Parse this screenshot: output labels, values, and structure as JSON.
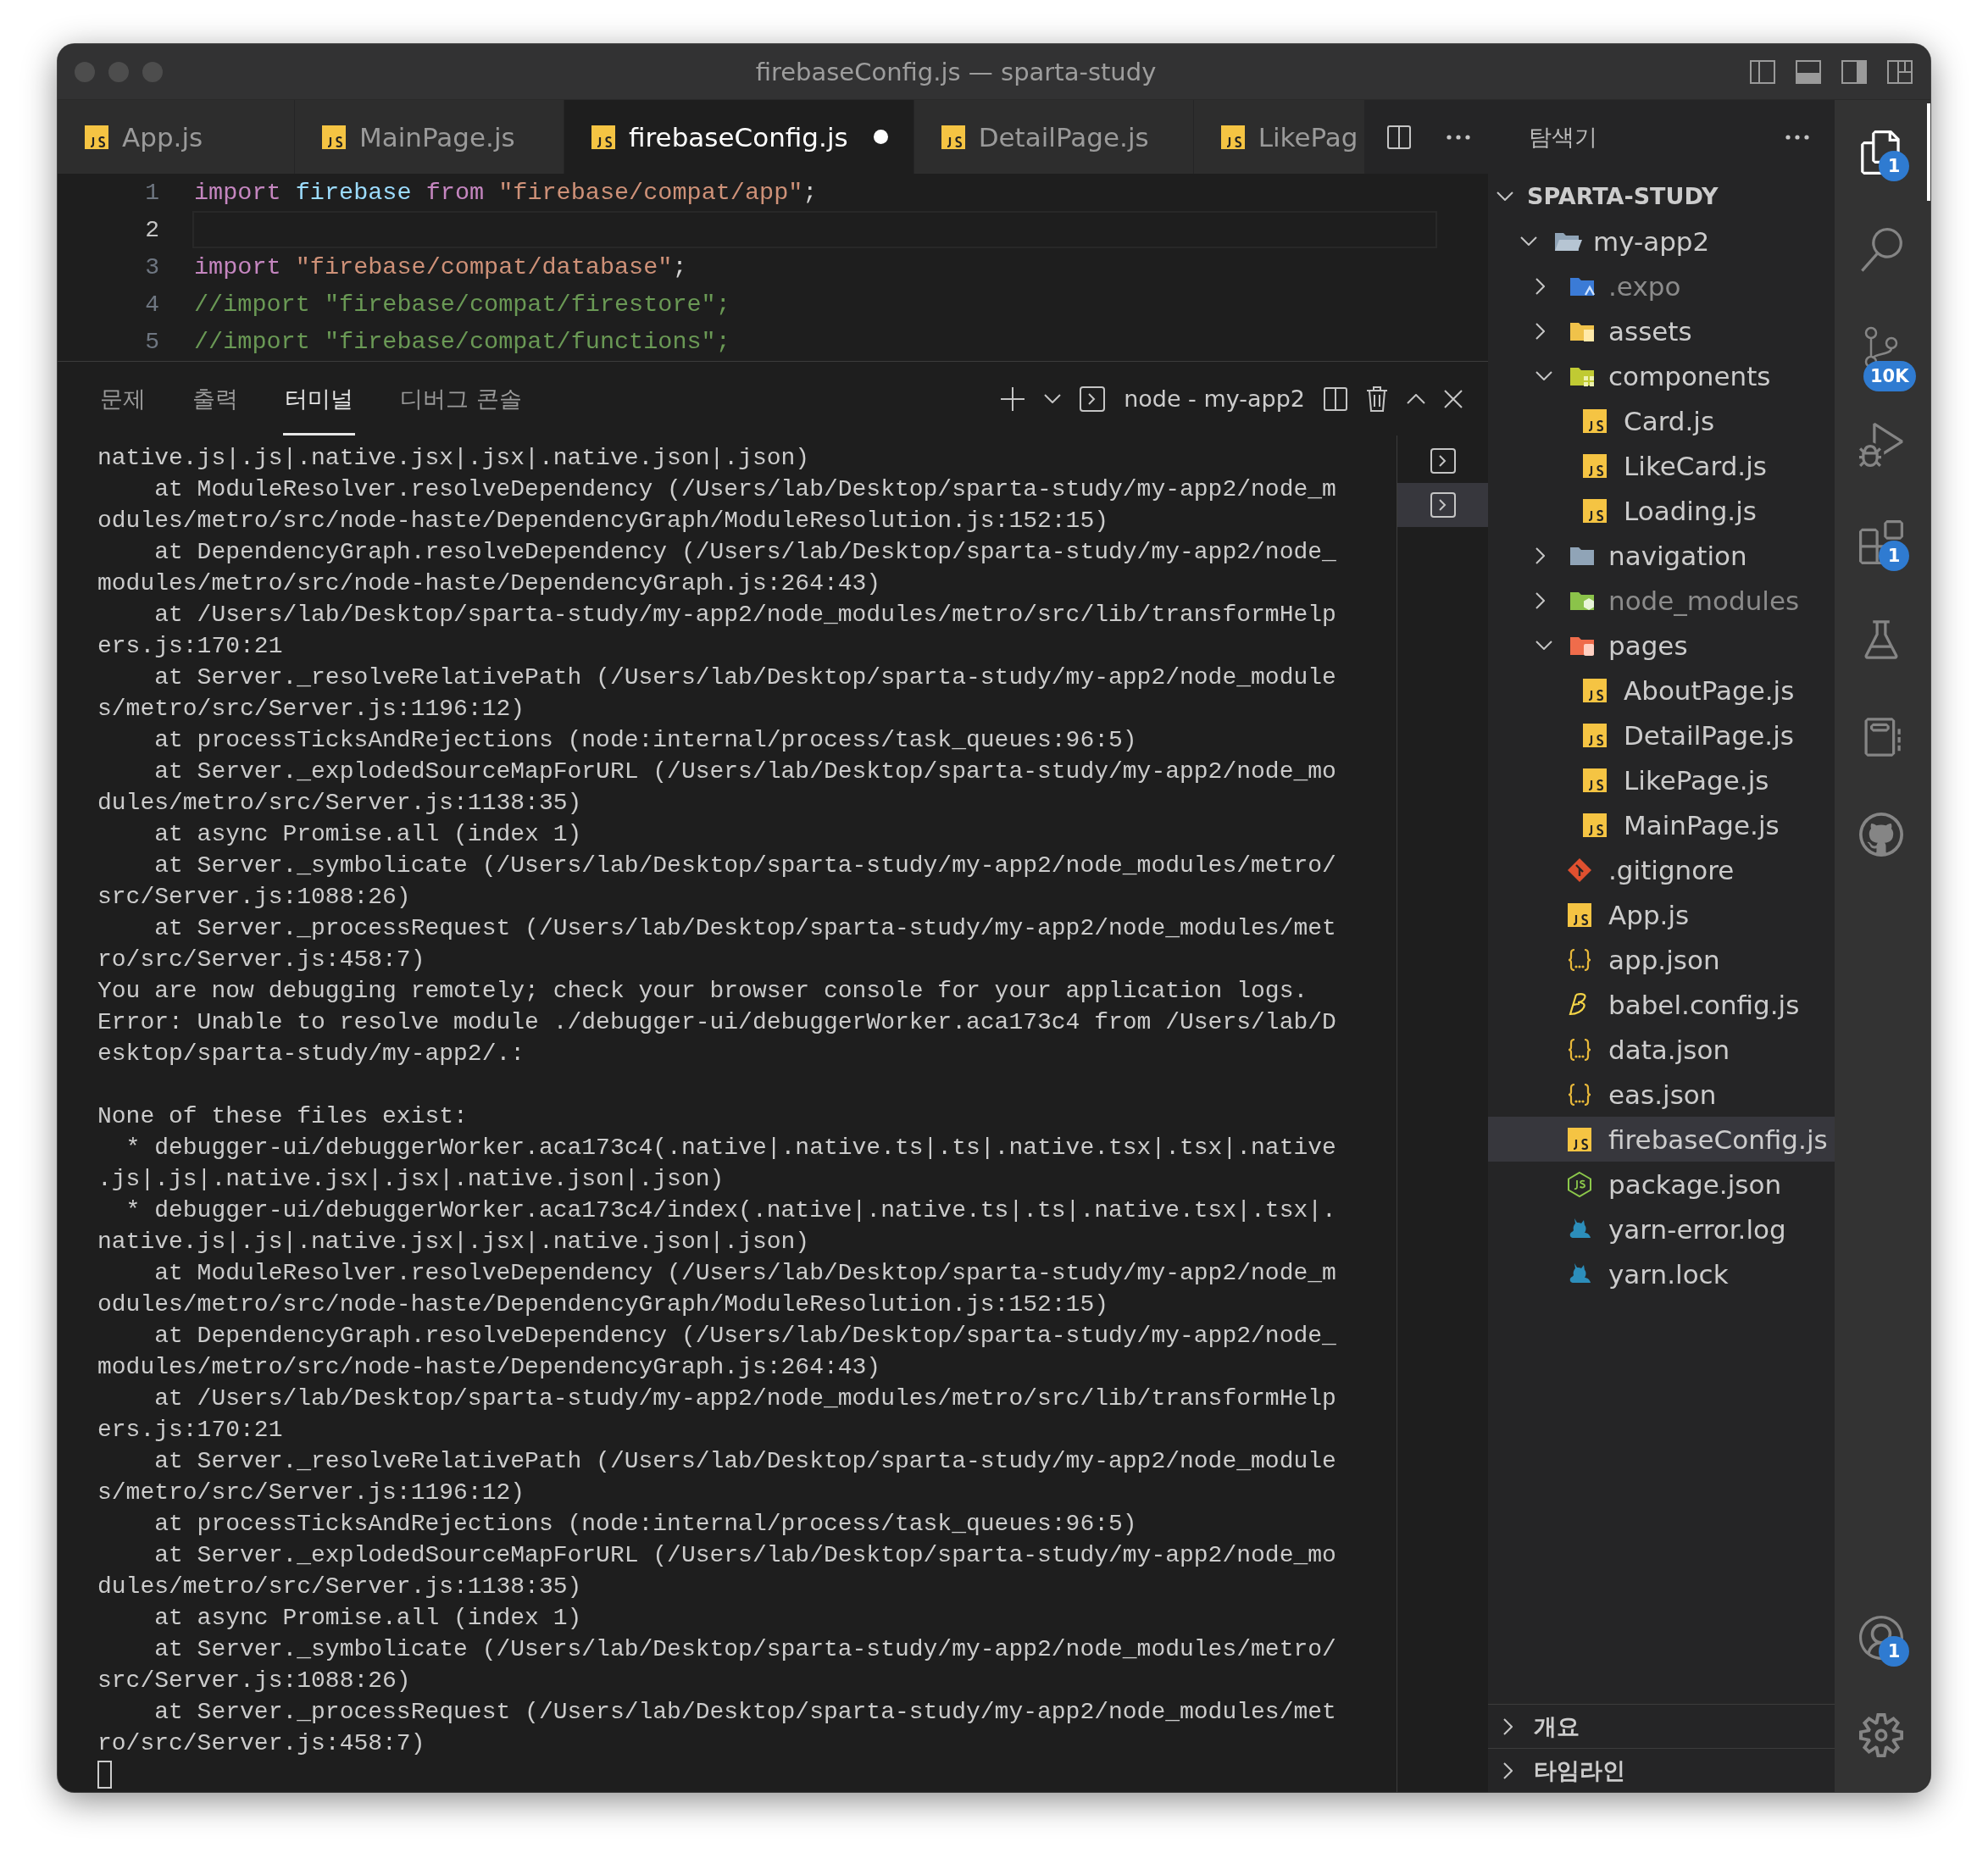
{
  "window": {
    "title": "firebaseConfig.js — sparta-study"
  },
  "editor_tabs": [
    {
      "label": "App.js",
      "kind": "js",
      "selected": false,
      "modified": false
    },
    {
      "label": "MainPage.js",
      "kind": "js",
      "selected": false,
      "modified": false
    },
    {
      "label": "firebaseConfig.js",
      "kind": "js",
      "selected": true,
      "modified": true
    },
    {
      "label": "DetailPage.js",
      "kind": "js",
      "selected": false,
      "modified": false
    },
    {
      "label": "LikePag",
      "kind": "js",
      "selected": false,
      "modified": false
    }
  ],
  "editor": {
    "lines": [
      {
        "number": "1",
        "current": false,
        "tokens": [
          {
            "kind": "keyword",
            "text": "import "
          },
          {
            "kind": "variable",
            "text": "firebase "
          },
          {
            "kind": "keyword",
            "text": "from "
          },
          {
            "kind": "string",
            "text": "\"firebase/compat/app\""
          },
          {
            "kind": "plain",
            "text": ";"
          }
        ]
      },
      {
        "number": "2",
        "current": true
      },
      {
        "number": "3",
        "current": false,
        "tokens": [
          {
            "kind": "keyword",
            "text": "import "
          },
          {
            "kind": "string",
            "text": "\"firebase/compat/database\""
          },
          {
            "kind": "plain",
            "text": ";"
          }
        ]
      },
      {
        "number": "4",
        "current": false,
        "tokens": [
          {
            "kind": "comment",
            "text": "//import \"firebase/compat/firestore\";"
          }
        ]
      },
      {
        "number": "5",
        "current": false,
        "tokens": [
          {
            "kind": "comment",
            "text": "//import \"firebase/compat/functions\";"
          }
        ]
      }
    ]
  },
  "panel": {
    "tabs": [
      {
        "label": "문제",
        "selected": false
      },
      {
        "label": "출력",
        "selected": false
      },
      {
        "label": "터미널",
        "selected": true
      },
      {
        "label": "디버그 콘솔",
        "selected": false
      }
    ],
    "terminal_name": "node - my-app2",
    "terminals": [
      {
        "selected": false
      },
      {
        "selected": true
      }
    ],
    "terminal": {
      "cursor": true,
      "blocks": [
        {
          "lines": [
            "native.js|.js|.native.jsx|.jsx|.native.json|.json)",
            "    at ModuleResolver.resolveDependency (/Users/lab/Desktop/sparta-study/my-app2/node_m",
            "odules/metro/src/node-haste/DependencyGraph/ModuleResolution.js:152:15)",
            "    at DependencyGraph.resolveDependency (/Users/lab/Desktop/sparta-study/my-app2/node_",
            "modules/metro/src/node-haste/DependencyGraph.js:264:43)",
            "    at /Users/lab/Desktop/sparta-study/my-app2/node_modules/metro/src/lib/transformHelp",
            "ers.js:170:21",
            "    at Server._resolveRelativePath (/Users/lab/Desktop/sparta-study/my-app2/node_module",
            "s/metro/src/Server.js:1196:12)",
            "    at processTicksAndRejections (node:internal/process/task_queues:96:5)",
            "    at Server._explodedSourceMapForURL (/Users/lab/Desktop/sparta-study/my-app2/node_mo",
            "dules/metro/src/Server.js:1138:35)",
            "    at async Promise.all (index 1)",
            "    at Server._symbolicate (/Users/lab/Desktop/sparta-study/my-app2/node_modules/metro/",
            "src/Server.js:1088:26)",
            "    at Server._processRequest (/Users/lab/Desktop/sparta-study/my-app2/node_modules/met",
            "ro/src/Server.js:458:7)",
            "You are now debugging remotely; check your browser console for your application logs.",
            "Error: Unable to resolve module ./debugger-ui/debuggerWorker.aca173c4 from /Users/lab/D",
            "esktop/sparta-study/my-app2/.:"
          ]
        },
        {
          "lines": [
            "None of these files exist:",
            "  * debugger-ui/debuggerWorker.aca173c4(.native|.native.ts|.ts|.native.tsx|.tsx|.native",
            ".js|.js|.native.jsx|.jsx|.native.json|.json)",
            "  * debugger-ui/debuggerWorker.aca173c4/index(.native|.native.ts|.ts|.native.tsx|.tsx|.",
            "native.js|.js|.native.jsx|.jsx|.native.json|.json)",
            "    at ModuleResolver.resolveDependency (/Users/lab/Desktop/sparta-study/my-app2/node_m",
            "odules/metro/src/node-haste/DependencyGraph/ModuleResolution.js:152:15)",
            "    at DependencyGraph.resolveDependency (/Users/lab/Desktop/sparta-study/my-app2/node_",
            "modules/metro/src/node-haste/DependencyGraph.js:264:43)",
            "    at /Users/lab/Desktop/sparta-study/my-app2/node_modules/metro/src/lib/transformHelp",
            "ers.js:170:21",
            "    at Server._resolveRelativePath (/Users/lab/Desktop/sparta-study/my-app2/node_module",
            "s/metro/src/Server.js:1196:12)",
            "    at processTicksAndRejections (node:internal/process/task_queues:96:5)",
            "    at Server._explodedSourceMapForURL (/Users/lab/Desktop/sparta-study/my-app2/node_mo",
            "dules/metro/src/Server.js:1138:35)",
            "    at async Promise.all (index 1)",
            "    at Server._symbolicate (/Users/lab/Desktop/sparta-study/my-app2/node_modules/metro/",
            "src/Server.js:1088:26)",
            "    at Server._processRequest (/Users/lab/Desktop/sparta-study/my-app2/node_modules/met",
            "ro/src/Server.js:458:7)"
          ]
        }
      ]
    }
  },
  "sidebar": {
    "title": "탐색기",
    "root": {
      "label": "SPARTA-STUDY",
      "expanded": true
    },
    "tree": [
      {
        "label": "my-app2",
        "kind": "folder-open",
        "expanded": true,
        "ignored": false,
        "selected": false,
        "children": [
          {
            "label": ".expo",
            "kind": "folder-expo",
            "expanded": false,
            "ignored": true,
            "selected": false
          },
          {
            "label": "assets",
            "kind": "folder-assets",
            "expanded": false,
            "ignored": false,
            "selected": false
          },
          {
            "label": "components",
            "kind": "folder-components",
            "expanded": true,
            "ignored": false,
            "selected": false,
            "children": [
              {
                "label": "Card.js",
                "kind": "js",
                "ignored": false,
                "selected": false
              },
              {
                "label": "LikeCard.js",
                "kind": "js",
                "ignored": false,
                "selected": false
              },
              {
                "label": "Loading.js",
                "kind": "js",
                "ignored": false,
                "selected": false
              }
            ]
          },
          {
            "label": "navigation",
            "kind": "folder",
            "expanded": false,
            "ignored": false,
            "selected": false
          },
          {
            "label": "node_modules",
            "kind": "folder-node",
            "expanded": false,
            "ignored": true,
            "selected": false
          },
          {
            "label": "pages",
            "kind": "folder-pages",
            "expanded": true,
            "ignored": false,
            "selected": false,
            "children": [
              {
                "label": "AboutPage.js",
                "kind": "js",
                "ignored": false,
                "selected": false
              },
              {
                "label": "DetailPage.js",
                "kind": "js",
                "ignored": false,
                "selected": false
              },
              {
                "label": "LikePage.js",
                "kind": "js",
                "ignored": false,
                "selected": false
              },
              {
                "label": "MainPage.js",
                "kind": "js",
                "ignored": false,
                "selected": false
              }
            ]
          },
          {
            "label": ".gitignore",
            "kind": "git",
            "ignored": false,
            "selected": false
          },
          {
            "label": "App.js",
            "kind": "js",
            "ignored": false,
            "selected": false
          },
          {
            "label": "app.json",
            "kind": "json",
            "ignored": false,
            "selected": false
          },
          {
            "label": "babel.config.js",
            "kind": "babel",
            "ignored": false,
            "selected": false
          },
          {
            "label": "data.json",
            "kind": "json",
            "ignored": false,
            "selected": false
          },
          {
            "label": "eas.json",
            "kind": "json",
            "ignored": false,
            "selected": false
          },
          {
            "label": "firebaseConfig.js",
            "kind": "js",
            "ignored": false,
            "selected": true
          },
          {
            "label": "package.json",
            "kind": "node",
            "ignored": false,
            "selected": false
          },
          {
            "label": "yarn-error.log",
            "kind": "yarn",
            "ignored": false,
            "selected": false
          },
          {
            "label": "yarn.lock",
            "kind": "yarn",
            "ignored": false,
            "selected": false
          }
        ]
      }
    ],
    "sections": [
      {
        "label": "개요",
        "expanded": false
      },
      {
        "label": "타임라인",
        "expanded": false
      }
    ]
  },
  "activity_bar": {
    "top": [
      {
        "kind": "explorer",
        "badge": "1",
        "selected": true
      },
      {
        "kind": "search",
        "selected": false
      },
      {
        "kind": "source-control",
        "badge": "10K",
        "selected": false
      },
      {
        "kind": "run-debug",
        "selected": false
      },
      {
        "kind": "extensions",
        "badge": "1",
        "selected": false
      },
      {
        "kind": "testing",
        "selected": false
      },
      {
        "kind": "notebook",
        "selected": false
      },
      {
        "kind": "github",
        "selected": false
      }
    ],
    "bottom": [
      {
        "kind": "account",
        "badge": "1",
        "selected": false
      },
      {
        "kind": "settings",
        "selected": false
      }
    ]
  }
}
